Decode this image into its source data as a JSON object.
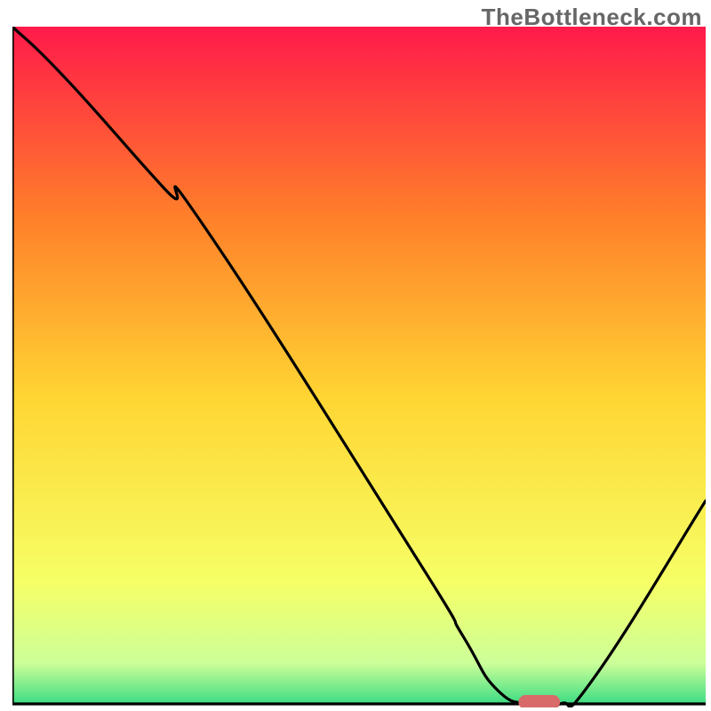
{
  "watermark": "TheBottleneck.com",
  "gradient": {
    "top": "#FF1A4A",
    "mid_upper": "#FF7F2A",
    "mid": "#FFD633",
    "mid_lower": "#F6FF66",
    "low": "#CCFF99",
    "bottom": "#3DDC84"
  },
  "marker_color": "#D96A6A",
  "chart_data": {
    "type": "line",
    "title": "",
    "xlabel": "",
    "ylabel": "",
    "xlim": [
      0,
      100
    ],
    "ylim": [
      0,
      100
    ],
    "series": [
      {
        "name": "bottleneck-curve",
        "x": [
          0,
          8,
          22,
          28,
          58,
          65,
          70,
          75,
          79,
          84,
          100
        ],
        "values": [
          100,
          92,
          76,
          70,
          22,
          10,
          2,
          0,
          0,
          4,
          30
        ]
      }
    ],
    "annotations": [
      {
        "name": "optimal-marker",
        "x_center": 76,
        "y": 0,
        "width_pct": 6,
        "color": "#D96A6A"
      }
    ]
  }
}
